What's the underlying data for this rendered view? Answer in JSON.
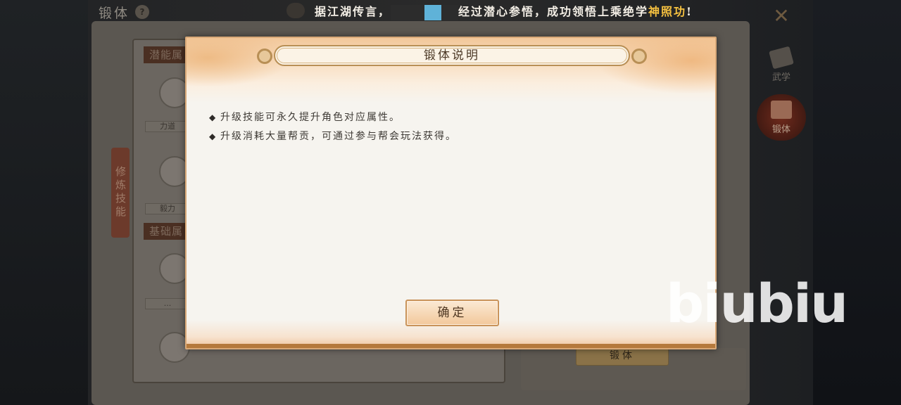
{
  "screen": {
    "title": "锻体",
    "help_icon": "question-icon",
    "side_tabs": [
      {
        "label": "武学",
        "icon": "scroll-book-icon",
        "active": false
      },
      {
        "label": "锻体",
        "icon": "body-armor-icon",
        "active": true
      }
    ],
    "vertical_tab": "修炼技能",
    "sections": {
      "potential": "潜能属",
      "basic": "基础属"
    },
    "skills": [
      {
        "name": "力道"
      },
      {
        "name": "毅力"
      },
      {
        "name": "..."
      }
    ],
    "forge_button": "锻体"
  },
  "marquee": {
    "prefix": "据江湖传言，",
    "middle": "经过潜心参悟，成功领悟上乘绝学",
    "highlight": "神照功",
    "suffix": "!"
  },
  "dialog": {
    "title": "锻体说明",
    "lines": [
      "升级技能可永久提升角色对应属性。",
      "升级消耗大量帮贡，可通过参与帮会玩法获得。"
    ],
    "bullet": "◆",
    "confirm_label": "确定"
  },
  "watermark": "biubiu",
  "colors": {
    "marquee_highlight": "#f5c140",
    "dialog_border": "#d9a978",
    "dialog_bg": "#f6f4ef"
  }
}
